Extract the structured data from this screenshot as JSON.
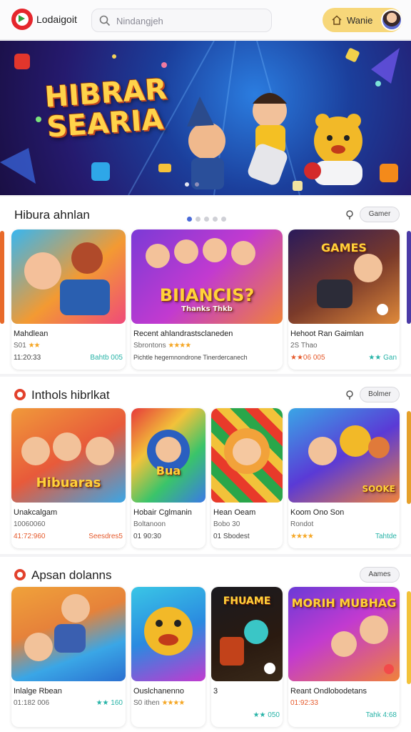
{
  "header": {
    "brand": "Lodaigoit",
    "search_placeholder": "Nindangjeh",
    "user_name": "Wanie"
  },
  "hero": {
    "title": "HIBRAR SEARIA"
  },
  "sections": [
    {
      "title": "Hibura ahnlan",
      "more_label": "Gamer",
      "cards": [
        {
          "thumb_label": "",
          "title": "Mahdlean",
          "line2": "S01",
          "stars": "★★",
          "line3": "11:20:33",
          "meta": "Bahtb 005",
          "meta_color": "#27b3a7"
        },
        {
          "thumb_label": "BIIANCIS?",
          "thumb_sub": "Thanks Thkb",
          "title": "Recent ahlandrastsclaneden",
          "line2": "Sbrontons",
          "stars": "★★★★",
          "line3": "Pichtle hegemnondrone Tinerdercanech",
          "meta": "",
          "meta_color": "#777"
        },
        {
          "thumb_label": "GAMES",
          "title": "Hehoot Ran Gaimlan",
          "line2": "2S Thao",
          "stars": "",
          "line3": "★★06 005",
          "meta": "★★ Gan",
          "meta_color": "#27b3a7"
        }
      ]
    },
    {
      "title": "Inthols hibrlkat",
      "more_label": "Bolmer",
      "cards": [
        {
          "thumb_label": "Hibuaras",
          "title": "Unakcalgam",
          "line2": "10060060",
          "stars": "",
          "line3": "41:72:960",
          "meta": "Seesdres5",
          "meta_color": "#e55a2c"
        },
        {
          "thumb_label": "Bua",
          "title": "Hobair Cglmanin",
          "line2": "Boltanoon",
          "stars": "",
          "line3": "01 90:30",
          "meta": "",
          "meta_color": "#777"
        },
        {
          "thumb_label": "",
          "title": "Hean Oeam",
          "line2": "Bobo 30",
          "stars": "",
          "line3": "01 Sbodest",
          "meta": "",
          "meta_color": "#777"
        },
        {
          "thumb_label": "SOOKE",
          "title": "Koom Ono Son",
          "line2": "Rondot",
          "stars": "★★★★",
          "line3": "",
          "meta": "Tahtde",
          "meta_color": "#27b3a7"
        }
      ]
    },
    {
      "title": "Apsan dolanns",
      "more_label": "Aames",
      "cards": [
        {
          "thumb_label": "",
          "title": "Inlalge Rbean",
          "line2": "01:182 006",
          "stars": "",
          "line3": "",
          "meta": "★★ 160",
          "meta_color": "#27b3a7"
        },
        {
          "thumb_label": "",
          "title": "Ouslchanenno",
          "line2": "S0 ithen",
          "stars": "★★★★",
          "line3": "",
          "meta": "",
          "meta_color": "#777"
        },
        {
          "thumb_label": "FHUAME",
          "title": "3",
          "line2": "",
          "stars": "",
          "line3": "",
          "meta": "★★ 050",
          "meta_color": "#27b3a7"
        },
        {
          "thumb_label": "MORIH MUBHAG",
          "title": "Reant Ondlobodetans",
          "line2": "01:92:33",
          "stars": "",
          "line3": "",
          "meta": "Tahk 4:68",
          "meta_color": "#27b3a7"
        }
      ]
    }
  ]
}
